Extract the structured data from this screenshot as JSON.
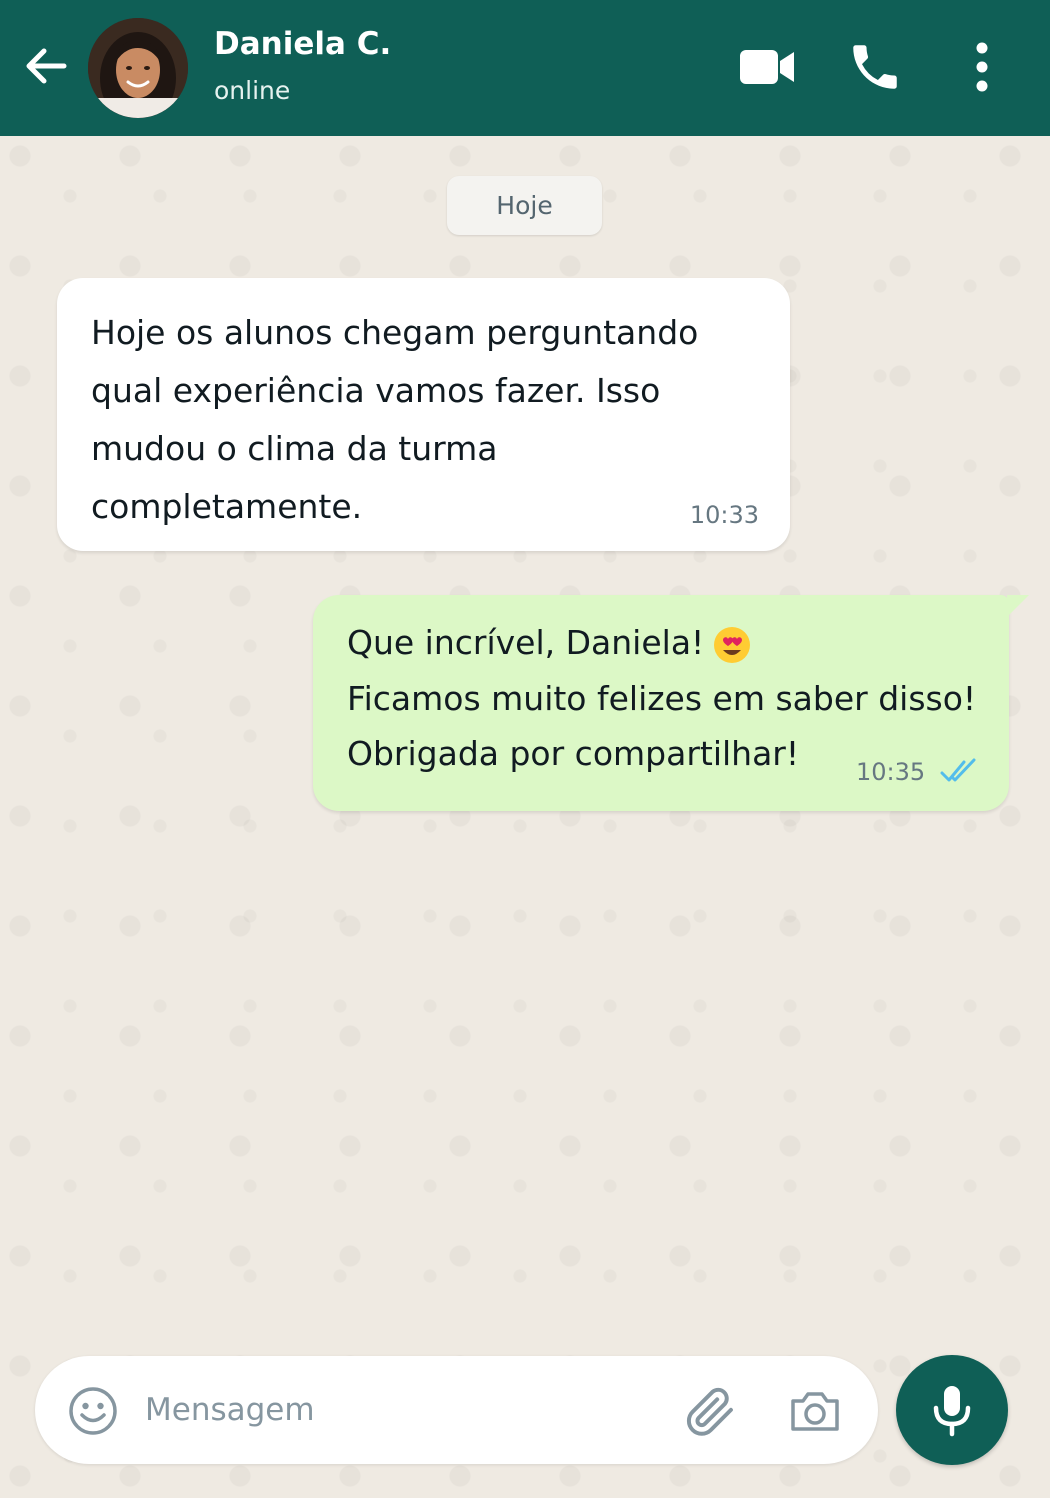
{
  "header": {
    "contact_name": "Daniela C.",
    "status": "online",
    "icons": {
      "back": "arrow-back-icon",
      "avatar": "avatar",
      "video": "video-camera-icon",
      "call": "phone-icon",
      "menu": "more-vertical-icon"
    }
  },
  "date_chip": "Hoje",
  "messages": [
    {
      "direction": "incoming",
      "text": "Hoje os alunos chegam perguntando qual experiência vamos fazer. Isso mudou o clima da turma completamente.",
      "time": "10:33"
    },
    {
      "direction": "outgoing",
      "lines": [
        "Que incrível, Daniela!",
        "Ficamos muito felizes em saber disso!",
        "Obrigada por compartilhar!"
      ],
      "emoji": "heart-eyes-emoji",
      "time": "10:35",
      "status": "read-double-check"
    }
  ],
  "input": {
    "placeholder": "Mensagem",
    "icons": {
      "emoji": "emoji-smile-icon",
      "attach": "paperclip-icon",
      "camera": "camera-icon",
      "mic": "microphone-icon"
    }
  },
  "colors": {
    "header": "#0f5f56",
    "wallpaper": "#efeae2",
    "incoming_bubble": "#ffffff",
    "outgoing_bubble": "#dcf8c6",
    "read_ticks": "#53bdeb",
    "mic_button": "#0f5f56"
  }
}
